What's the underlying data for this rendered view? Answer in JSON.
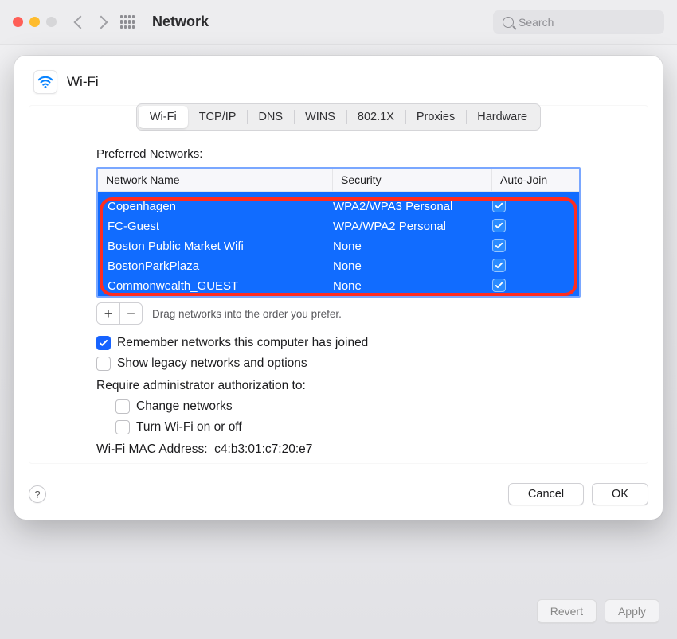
{
  "window": {
    "title": "Network",
    "search_placeholder": "Search"
  },
  "bg_buttons": {
    "revert": "Revert",
    "apply": "Apply"
  },
  "sheet": {
    "title": "Wi-Fi",
    "tabs": [
      "Wi-Fi",
      "TCP/IP",
      "DNS",
      "WINS",
      "802.1X",
      "Proxies",
      "Hardware"
    ],
    "active_tab_index": 0,
    "preferred_label": "Preferred Networks:",
    "columns": {
      "name": "Network Name",
      "security": "Security",
      "autojoin": "Auto-Join"
    },
    "networks": [
      {
        "name": "Copenhagen",
        "security": "WPA2/WPA3 Personal",
        "autojoin": true
      },
      {
        "name": "FC-Guest",
        "security": "WPA/WPA2 Personal",
        "autojoin": true
      },
      {
        "name": "Boston Public Market Wifi",
        "security": "None",
        "autojoin": true
      },
      {
        "name": "BostonParkPlaza",
        "security": "None",
        "autojoin": true
      },
      {
        "name": "Commonwealth_GUEST",
        "security": "None",
        "autojoin": true
      }
    ],
    "drag_hint": "Drag networks into the order you prefer.",
    "remember": {
      "label": "Remember networks this computer has joined",
      "checked": true
    },
    "legacy": {
      "label": "Show legacy networks and options",
      "checked": false
    },
    "auth_label": "Require administrator authorization to:",
    "auth_change": {
      "label": "Change networks",
      "checked": false
    },
    "auth_wifi": {
      "label": "Turn Wi-Fi on or off",
      "checked": false
    },
    "mac_label": "Wi-Fi MAC Address:",
    "mac_value": "c4:b3:01:c7:20:e7",
    "buttons": {
      "help": "?",
      "cancel": "Cancel",
      "ok": "OK",
      "plus": "+",
      "minus": "−"
    }
  }
}
